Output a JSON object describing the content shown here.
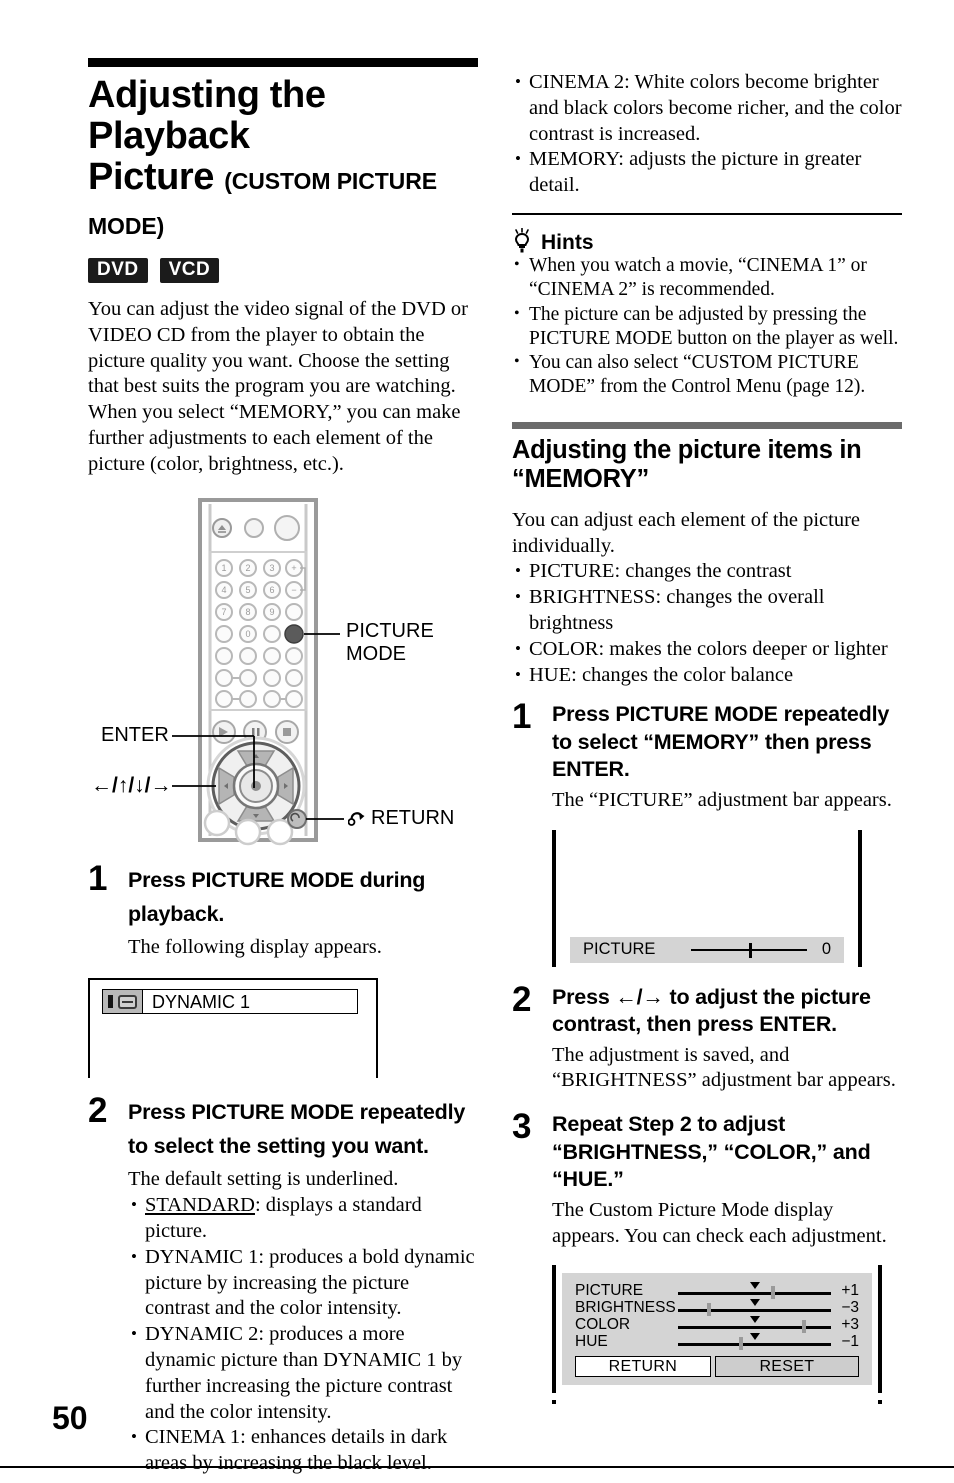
{
  "page": {
    "number": "50"
  },
  "left": {
    "title_main": "Adjusting the Playback Picture",
    "title_line1": "Adjusting the Playback",
    "title_line2": "Picture",
    "title_sub": "(CUSTOM PICTURE MODE)",
    "badges": [
      "DVD",
      "VCD"
    ],
    "intro": "You can adjust the video signal of the DVD or VIDEO CD from the player to obtain the picture quality you want. Choose the setting that best suits the program you are watching. When you select “MEMORY,” you can make further adjustments to each element of the picture (color, brightness, etc.).",
    "remote": {
      "callout_picture_mode_line1": "PICTURE",
      "callout_picture_mode_line2": "MODE",
      "callout_enter": "ENTER",
      "callout_arrows": "←/↑/↓/→",
      "callout_return": "RETURN",
      "keypad_digits": [
        "1",
        "2",
        "3",
        "4",
        "5",
        "6",
        "7",
        "8",
        "9",
        "0"
      ]
    },
    "step1": {
      "num": "1",
      "head": "Press PICTURE MODE during playback.",
      "body": "The following display appears."
    },
    "osd_dynamic": {
      "label": "DYNAMIC 1"
    },
    "step2": {
      "num": "2",
      "head": "Press PICTURE MODE repeatedly to select the setting you want.",
      "body": "The default setting is underlined.",
      "options": [
        {
          "name": "STANDARD",
          "underline": true,
          "text": ": displays a standard picture."
        },
        {
          "name": "DYNAMIC 1",
          "underline": false,
          "text": ": produces a bold dynamic picture by increasing the picture contrast and the color intensity."
        },
        {
          "name": "DYNAMIC 2",
          "underline": false,
          "text": ": produces a more dynamic picture than DYNAMIC 1 by further increasing the picture contrast and the color intensity."
        },
        {
          "name": "CINEMA 1",
          "underline": false,
          "text": ": enhances details in dark areas by increasing the black level."
        }
      ]
    }
  },
  "right": {
    "options_cont": [
      {
        "name": "CINEMA 2",
        "text": ": White colors become brighter and black colors become richer, and the color contrast is increased."
      },
      {
        "name": "MEMORY",
        "text": ": adjusts the picture in greater detail."
      }
    ],
    "hints": {
      "heading": "Hints",
      "items": [
        "When you watch a movie, “CINEMA 1” or “CINEMA 2” is recommended.",
        "The picture can be adjusted by pressing the PICTURE MODE button on the player as well.",
        "You can also select “CUSTOM PICTURE MODE” from the Control Menu (page 12)."
      ]
    },
    "section": {
      "heading_line1": "Adjusting the picture items in",
      "heading_line2": "“MEMORY”",
      "intro": "You can adjust each element of the picture individually.",
      "items": [
        {
          "name": "PICTURE",
          "text": ": changes the contrast"
        },
        {
          "name": "BRIGHTNESS",
          "text": ": changes the overall brightness"
        },
        {
          "name": "COLOR",
          "text": ": makes the colors deeper or lighter"
        },
        {
          "name": "HUE",
          "text": ": changes the color balance"
        }
      ]
    },
    "step1": {
      "num": "1",
      "head": "Press PICTURE MODE repeatedly to select “MEMORY” then press ENTER.",
      "body": "The “PICTURE” adjustment bar appears."
    },
    "step2": {
      "num": "2",
      "head": "Press ←/→ to adjust the picture contrast, then press ENTER.",
      "body": "The adjustment is saved, and “BRIGHTNESS” adjustment bar appears."
    },
    "step3": {
      "num": "3",
      "head": "Repeat Step 2 to adjust “BRIGHTNESS,” “COLOR,” and “HUE.”",
      "body": "The Custom Picture Mode display appears. You can check each adjustment."
    }
  },
  "osd_picture_bar": {
    "label": "PICTURE",
    "value": "0",
    "knob_percent": 50
  },
  "osd_custom_picture_mode": {
    "rows": [
      {
        "label": "PICTURE",
        "value": "+1",
        "knob_percent": 61
      },
      {
        "label": "BRIGHTNESS",
        "value": "−3",
        "knob_percent": 19
      },
      {
        "label": "COLOR",
        "value": "+3",
        "knob_percent": 81
      },
      {
        "label": "HUE",
        "value": "−1",
        "knob_percent": 40
      }
    ],
    "buttons": {
      "return": "RETURN",
      "reset": "RESET"
    }
  }
}
